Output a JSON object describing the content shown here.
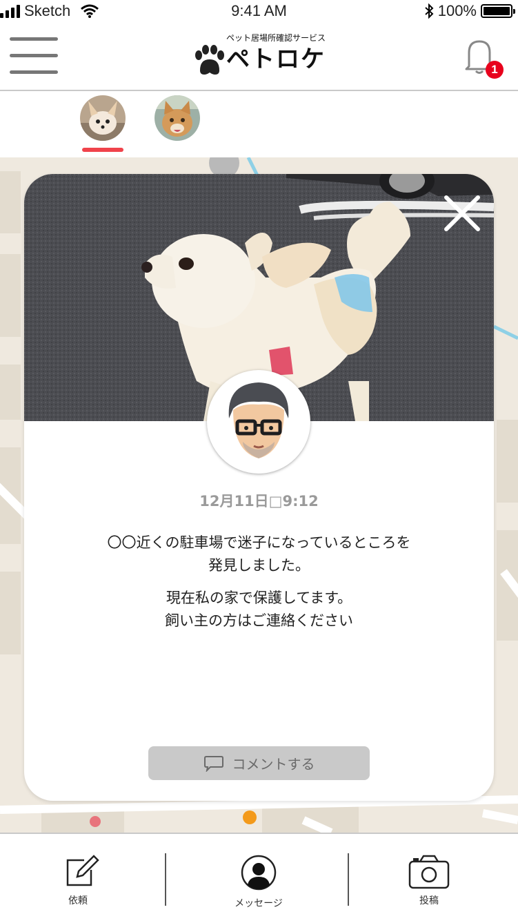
{
  "status_bar": {
    "carrier": "Sketch",
    "time": "9:41 AM",
    "battery": "100%"
  },
  "header": {
    "logo_subtitle": "ペット居場所確認サービス",
    "logo_title": "ペトロケ",
    "notification_count": "1"
  },
  "pets": [
    {
      "name": "chihuahua-avatar",
      "selected": true
    },
    {
      "name": "cat-avatar",
      "selected": false
    }
  ],
  "card": {
    "date": "12月11日□9:12",
    "message_line1": "〇〇近くの駐車場で迷子になっているところを",
    "message_line2": "発見しました。",
    "message_line3": "現在私の家で保護してます。",
    "message_line4": "飼い主の方はご連絡ください",
    "comment_label": "コメントする"
  },
  "tabs": {
    "request": "依頼",
    "message": "メッセージ",
    "post": "投稿"
  },
  "colors": {
    "accent_red": "#f0434b",
    "badge_red": "#e8001c",
    "map_bg": "#efe9df",
    "button_gray": "#c9c9c9"
  }
}
